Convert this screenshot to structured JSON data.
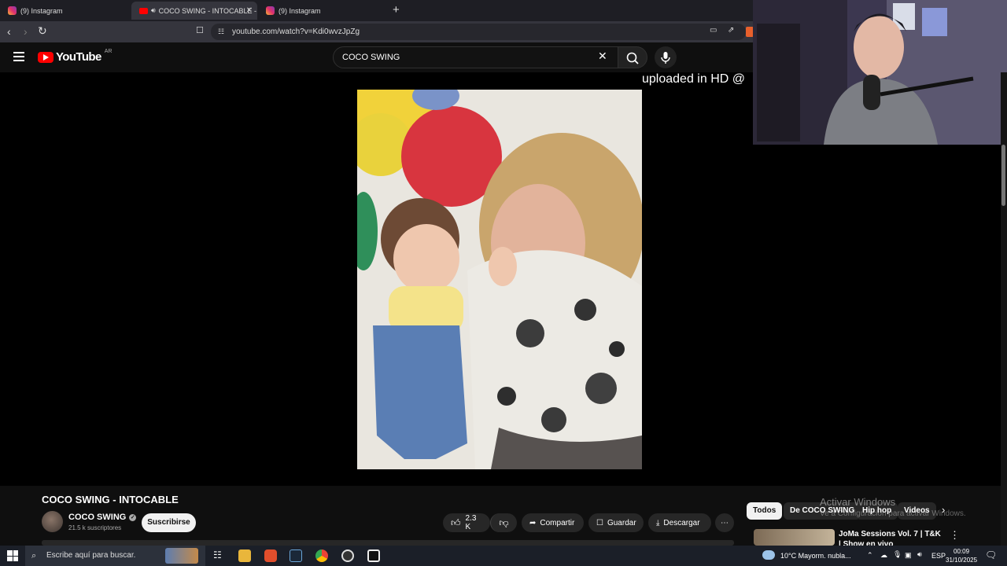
{
  "browser": {
    "tabs": [
      {
        "label": "(9) Instagram",
        "icon": "instagram-icon",
        "active": false
      },
      {
        "label": "COCO SWING - INTOCABLE -",
        "icon": "youtube-icon",
        "active": true
      },
      {
        "label": "(9) Instagram",
        "icon": "instagram-icon",
        "active": false
      }
    ],
    "new_tab_label": "+",
    "url": "youtube.com/watch?v=Kdi0wvzJpZg"
  },
  "youtube": {
    "logo_text": "YouTube",
    "country_code": "AR",
    "search_value": "COCO SWING",
    "video": {
      "watermark": "uploaded in HD @",
      "title": "COCO SWING - INTOCABLE",
      "channel": "COCO SWING",
      "subscribers": "21.5 k suscriptores",
      "subscribe_label": "Suscribirse",
      "likes": "2.3 K",
      "share_label": "Compartir",
      "save_label": "Guardar",
      "download_label": "Descargar"
    },
    "chips": [
      "Todos",
      "De COCO SWING",
      "Hip hop",
      "Videos"
    ],
    "recommendation": {
      "title": "JoMa Sessions Vol. 7 | T&K | Show en vivo"
    }
  },
  "windows_activation": {
    "line1": "Activar Windows",
    "line2": "Ve a Configuración para activar Windows."
  },
  "taskbar": {
    "search_placeholder": "Escribe aquí para buscar.",
    "weather": "10°C  Mayorm. nubla...",
    "language": "ESP",
    "time": "00:09",
    "date": "31/10/2025"
  }
}
